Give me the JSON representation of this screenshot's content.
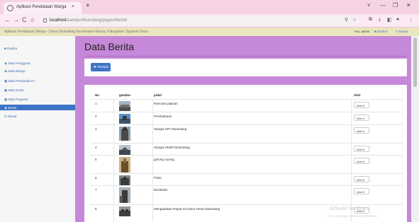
{
  "browser": {
    "tab_title": "Aplikasi Pendataan Warga",
    "tab_close": "×",
    "new_tab": "+",
    "window_controls": [
      "˅",
      "—",
      "❐",
      "✕"
    ],
    "nav": [
      "←",
      "→",
      "C",
      "⌂"
    ],
    "url_host": "localhost",
    "url_path": "/sampurdisandang/pages/berita/",
    "toolbar_icons": [
      "⚲",
      "☆",
      "⧉",
      "⤓",
      "◧",
      "●",
      "⋮"
    ]
  },
  "header": {
    "brand": "Aplikasi Pendataan Warga - Desa Disandang Kecamatan Muara, Kabupaten Tapanuli Utara",
    "user": "Hai, admin",
    "link1": "Dasbor",
    "link2": "Keluar"
  },
  "sidebar": {
    "items": [
      {
        "label": "Dasbor",
        "icon": "dashboard-icon"
      },
      {
        "label": "Data Pengguna",
        "icon": "user-icon"
      },
      {
        "label": "Data Warga",
        "icon": "users-icon"
      },
      {
        "label": "Data Penduduk KT",
        "icon": "card-icon"
      },
      {
        "label": "Data Surat",
        "icon": "card-icon"
      },
      {
        "label": "Data Pegawai",
        "icon": "card-icon"
      },
      {
        "label": "Berita",
        "icon": "news-icon",
        "active": true
      },
      {
        "label": "Keluar",
        "icon": "logout-icon"
      }
    ]
  },
  "main": {
    "title": "Data Berita",
    "add_button": "Tambah",
    "columns": [
      "No",
      "gambar",
      "judul",
      "Aksi"
    ],
    "rows": [
      {
        "no": "1",
        "judul": "Rencana jalanan",
        "aksi": "Aksi ▾"
      },
      {
        "no": "2",
        "judul": "Pembakaran",
        "aksi": "Aksi ▾"
      },
      {
        "no": "3",
        "judul": "Sarapa GPI Disandang",
        "aksi": "Aksi ▾"
      },
      {
        "no": "4",
        "judul": "Sarapa HKBP Disandang",
        "aksi": "Aksi ▾"
      },
      {
        "no": "5",
        "judul": "gotong royong",
        "aksi": "Aksi ▾"
      },
      {
        "no": "6",
        "judul": "Polisi",
        "aksi": "Aksi ▾"
      },
      {
        "no": "7",
        "judul": "Disnkaksi",
        "aksi": "Aksi ▾"
      },
      {
        "no": "8",
        "judul": "Mengadakan Rapat di Kantor Desa Disandang",
        "aksi": "Aksi ▾"
      }
    ]
  },
  "watermark": {
    "line1": "Activate Windows",
    "line2": "Go to Settings to activate Windows."
  },
  "colors": {
    "main_bg": "#c688d8",
    "accent": "#3d74c5",
    "header_bg": "#eae6bd"
  }
}
